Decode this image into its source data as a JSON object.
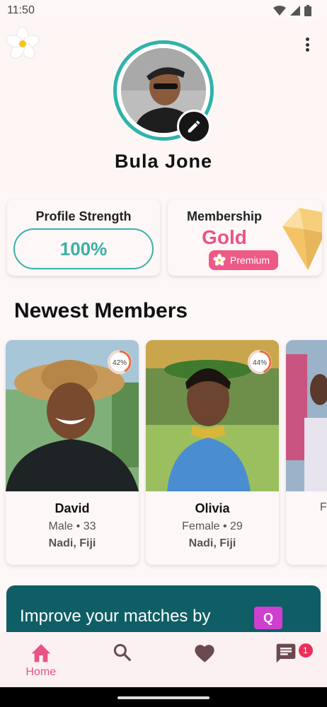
{
  "status_bar": {
    "time": "11:50"
  },
  "profile": {
    "name": "Bula Jone"
  },
  "profile_strength": {
    "title": "Profile Strength",
    "value": "100%"
  },
  "membership": {
    "title": "Membership",
    "tier": "Gold",
    "badge": "Premium"
  },
  "newest_members": {
    "title": "Newest Members",
    "members": [
      {
        "name": "David",
        "meta": "Male • 33",
        "location": "Nadi, Fiji",
        "match": "42%"
      },
      {
        "name": "Olivia",
        "meta": "Female • 29",
        "location": "Nadi, Fiji",
        "match": "44%"
      },
      {
        "name": "",
        "meta": "F",
        "location": "",
        "match": ""
      }
    ]
  },
  "promo": {
    "text": "Improve your matches by",
    "badge": "Q"
  },
  "bottom_nav": {
    "home": "Home",
    "messages_badge": "1"
  },
  "colors": {
    "accent": "#e95487",
    "teal": "#2fb3a9"
  }
}
